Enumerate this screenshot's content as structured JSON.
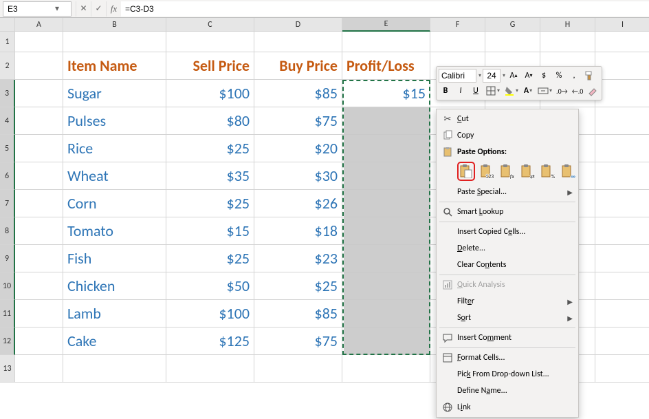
{
  "name_box": "E3",
  "formula": "=C3-D3",
  "columns": [
    "A",
    "B",
    "C",
    "D",
    "E",
    "F",
    "G",
    "H",
    "I"
  ],
  "rows": [
    "1",
    "2",
    "3",
    "4",
    "5",
    "6",
    "7",
    "8",
    "9",
    "10",
    "11",
    "12",
    "13"
  ],
  "headers": {
    "b": "Item Name",
    "c": "Sell Price",
    "d": "Buy Price",
    "e": "Profit/Loss"
  },
  "items": [
    {
      "name": "Sugar",
      "sell": "$100",
      "buy": "$85",
      "pl": "$15"
    },
    {
      "name": "Pulses",
      "sell": "$80",
      "buy": "$75",
      "pl": ""
    },
    {
      "name": "Rice",
      "sell": "$25",
      "buy": "$20",
      "pl": ""
    },
    {
      "name": "Wheat",
      "sell": "$35",
      "buy": "$30",
      "pl": ""
    },
    {
      "name": "Corn",
      "sell": "$25",
      "buy": "$26",
      "pl": ""
    },
    {
      "name": "Tomato",
      "sell": "$15",
      "buy": "$18",
      "pl": ""
    },
    {
      "name": "Fish",
      "sell": "$25",
      "buy": "$23",
      "pl": ""
    },
    {
      "name": "Chicken",
      "sell": "$50",
      "buy": "$25",
      "pl": ""
    },
    {
      "name": "Lamb",
      "sell": "$100",
      "buy": "$85",
      "pl": ""
    },
    {
      "name": "Cake",
      "sell": "$125",
      "buy": "$75",
      "pl": ""
    }
  ],
  "mini_toolbar": {
    "font": "Calibri",
    "size": "24"
  },
  "context_menu": {
    "cut": "Cut",
    "copy": "Copy",
    "paste_header": "Paste Options:",
    "paste_special": "Paste Special...",
    "smart_lookup": "Smart Lookup",
    "insert_copied": "Insert Copied Cells...",
    "delete": "Delete...",
    "clear": "Clear Contents",
    "quick_analysis": "Quick Analysis",
    "filter": "Filter",
    "sort": "Sort",
    "insert_comment": "Insert Comment",
    "format_cells": "Format Cells...",
    "pick_list": "Pick From Drop-down List...",
    "define_name": "Define Name...",
    "link": "Link"
  }
}
